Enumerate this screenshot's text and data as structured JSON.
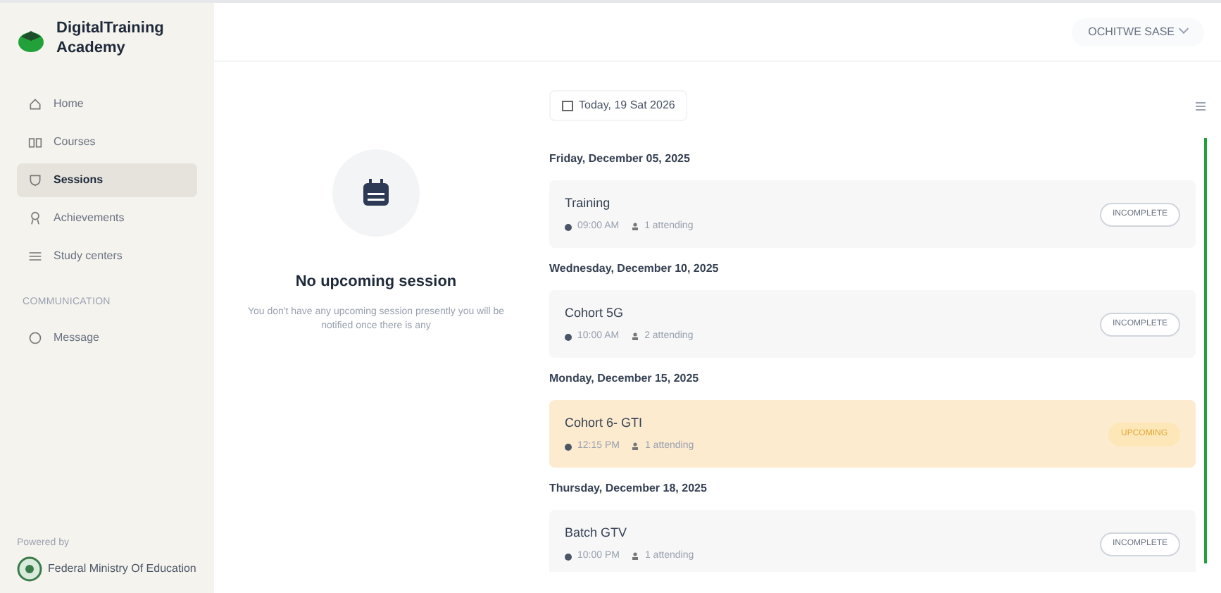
{
  "sidebar": {
    "brand": "DigitalTraining Academy",
    "items": [
      {
        "label": "Home",
        "selected": false
      },
      {
        "label": "Courses",
        "selected": false
      },
      {
        "label": "Sessions",
        "selected": true
      },
      {
        "label": "Achievements",
        "selected": false
      },
      {
        "label": "Study centers",
        "selected": false
      }
    ],
    "section": "COMMUNICATION",
    "section_items": [
      {
        "label": "Message",
        "selected": false
      }
    ],
    "footer_caption": "Powered by",
    "footer_org": "Federal Ministry Of Education"
  },
  "header": {
    "user": "OCHITWE SASE"
  },
  "empty_state": {
    "title": "No upcoming session",
    "text": "You don't have any upcoming session presently you will be notified once there is any"
  },
  "sessions": {
    "today": "Today, 19 Sat 2026",
    "groups": [
      {
        "date": "Friday, December 05, 2025",
        "items": [
          {
            "title": "Training",
            "time": "09:00 AM",
            "attending": "1 attending",
            "badge": "INCOMPLETE",
            "highlighted": false
          }
        ]
      },
      {
        "date": "Wednesday, December 10, 2025",
        "items": [
          {
            "title": "Cohort 5G",
            "time": "10:00 AM",
            "attending": "2 attending",
            "badge": "INCOMPLETE",
            "highlighted": false
          }
        ]
      },
      {
        "date": "Monday, December 15, 2025",
        "items": [
          {
            "title": "Cohort 6- GTI",
            "time": "12:15 PM",
            "attending": "1 attending",
            "badge": "UPCOMING",
            "highlighted": true
          }
        ]
      },
      {
        "date": "Thursday, December 18, 2025",
        "items": [
          {
            "title": "Batch GTV",
            "time": "10:00 PM",
            "attending": "1 attending",
            "badge": "INCOMPLETE",
            "highlighted": false
          }
        ]
      }
    ]
  }
}
